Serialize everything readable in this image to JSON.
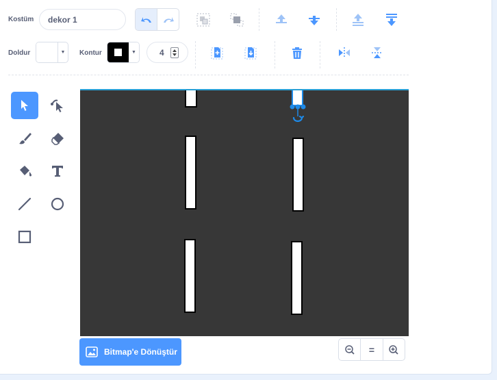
{
  "header": {
    "costume_label": "Kostüm",
    "costume_name": "dekor 1"
  },
  "history": {
    "undo_icon": "undo-icon",
    "redo_icon": "redo-icon"
  },
  "arrange": {
    "group_icon": "group-icon",
    "ungroup_icon": "ungroup-icon",
    "forward_icon": "forward-icon",
    "backward_icon": "backward-icon",
    "front_icon": "front-icon",
    "back_icon": "back-icon"
  },
  "style": {
    "fill_label": "Doldur",
    "outline_label": "Kontur",
    "outline_width": "4",
    "fill_color": "#ffffff",
    "outline_color": "#000000"
  },
  "actions": {
    "copy_icon": "copy-icon",
    "paste_icon": "paste-icon",
    "delete_icon": "trash-icon",
    "flip_h_icon": "flip-horizontal-icon",
    "flip_v_icon": "flip-vertical-icon"
  },
  "tools": [
    "select",
    "reshape",
    "brush",
    "eraser",
    "fill",
    "text",
    "line",
    "circle",
    "rectangle"
  ],
  "selected_tool": "select",
  "canvas": {
    "background_color": "#373737",
    "lane_color": "#ffffff"
  },
  "footer": {
    "convert_label": "Bitmap'e Dönüştür",
    "zoom_reset_label": "="
  },
  "colors": {
    "accent": "#4c97ff",
    "text": "#575e75"
  }
}
